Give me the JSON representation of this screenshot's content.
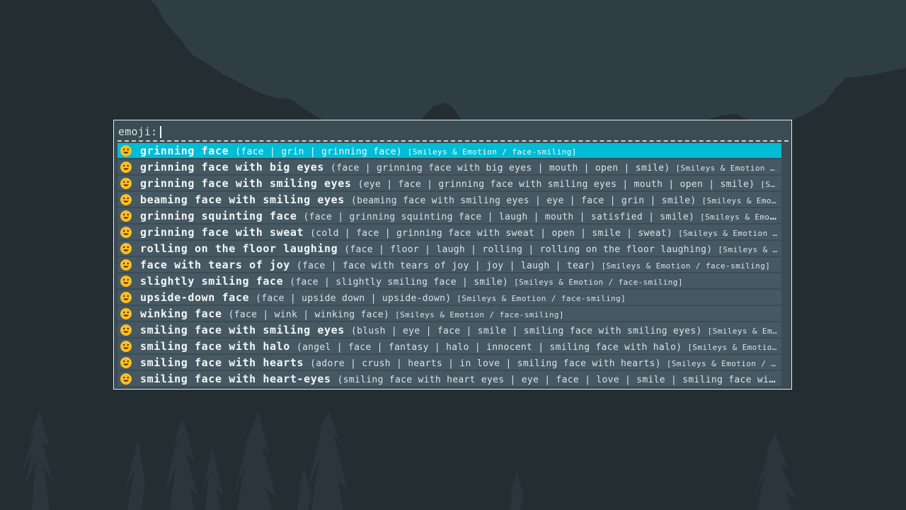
{
  "launcher": {
    "prompt_label": "emoji:",
    "query": "",
    "selected_index": 0,
    "colors": {
      "background": "#232d32",
      "window": "#3b4c55",
      "row": "#465862",
      "selected_row": "#00bcd4",
      "border": "#e6ecee"
    }
  },
  "results": [
    {
      "icon": "grinning-face-icon",
      "glyph": "😀",
      "name": "grinning face",
      "keywords": "(face | grin | grinning face)",
      "category": "[Smileys & Emotion / face-smiling]"
    },
    {
      "icon": "grinning-face-big-eyes-icon",
      "glyph": "😃",
      "name": "grinning face with big eyes",
      "keywords": "(face | grinning face with big eyes | mouth | open | smile)",
      "category": "[Smileys & Emotion …"
    },
    {
      "icon": "grinning-face-smiling-eyes-icon",
      "glyph": "😄",
      "name": "grinning face with smiling eyes",
      "keywords": "(eye | face | grinning face with smiling eyes | mouth | open | smile)",
      "category": "[S…"
    },
    {
      "icon": "beaming-face-icon",
      "glyph": "😁",
      "name": "beaming face with smiling eyes",
      "keywords": "(beaming face with smiling eyes | eye | face | grin | smile)",
      "category": "[Smileys & Emo…"
    },
    {
      "icon": "grinning-squinting-face-icon",
      "glyph": "😆",
      "name": "grinning squinting face",
      "keywords": "(face | grinning squinting face | laugh | mouth | satisfied | smile)",
      "category": "[Smileys & Emot…"
    },
    {
      "icon": "grinning-face-sweat-icon",
      "glyph": "😅",
      "name": "grinning face with sweat",
      "keywords": "(cold | face | grinning face with sweat | open | smile | sweat)",
      "category": "[Smileys & Emotion …"
    },
    {
      "icon": "rolling-on-floor-laughing-icon",
      "glyph": "🤣",
      "name": "rolling on the floor laughing",
      "keywords": "(face | floor | laugh | rolling | rolling on the floor laughing)",
      "category": "[Smileys & …"
    },
    {
      "icon": "face-tears-of-joy-icon",
      "glyph": "😂",
      "name": "face with tears of joy",
      "keywords": "(face | face with tears of joy | joy | laugh | tear)",
      "category": "[Smileys & Emotion / face-smiling]"
    },
    {
      "icon": "slightly-smiling-face-icon",
      "glyph": "🙂",
      "name": "slightly smiling face",
      "keywords": "(face | slightly smiling face | smile)",
      "category": "[Smileys & Emotion / face-smiling]"
    },
    {
      "icon": "upside-down-face-icon",
      "glyph": "🙃",
      "name": "upside-down face",
      "keywords": "(face | upside down | upside-down)",
      "category": "[Smileys & Emotion / face-smiling]"
    },
    {
      "icon": "winking-face-icon",
      "glyph": "😉",
      "name": "winking face",
      "keywords": "(face | wink | winking face)",
      "category": "[Smileys & Emotion / face-smiling]"
    },
    {
      "icon": "smiling-face-smiling-eyes-icon",
      "glyph": "😊",
      "name": "smiling face with smiling eyes",
      "keywords": "(blush | eye | face | smile | smiling face with smiling eyes)",
      "category": "[Smileys & Em…"
    },
    {
      "icon": "smiling-face-halo-icon",
      "glyph": "😇",
      "name": "smiling face with halo",
      "keywords": "(angel | face | fantasy | halo | innocent | smiling face with halo)",
      "category": "[Smileys & Emotio…"
    },
    {
      "icon": "smiling-face-hearts-icon",
      "glyph": "🥰",
      "name": "smiling face with hearts",
      "keywords": "(adore | crush | hearts | in love | smiling face with hearts)",
      "category": "[Smileys & Emotion / …"
    },
    {
      "icon": "smiling-face-heart-eyes-icon",
      "glyph": "😍",
      "name": "smiling face with heart-eyes",
      "keywords": "(smiling face with heart eyes | eye | face | love | smile | smiling face wit…",
      "category": ""
    }
  ]
}
